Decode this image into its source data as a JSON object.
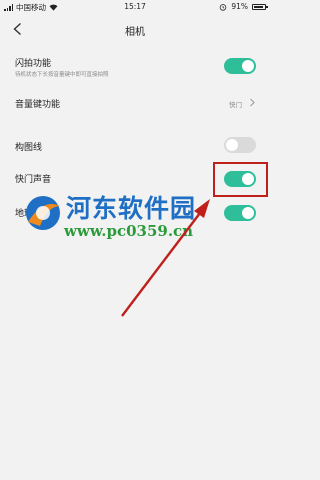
{
  "status_bar": {
    "carrier": "中国移动",
    "time": "15:17",
    "battery": "91%",
    "battery_level": 0.91
  },
  "header": {
    "title": "相机"
  },
  "settings": {
    "flash_capture": {
      "label": "闪拍功能",
      "description": "待机状态下长按音量键中即可直接拍照",
      "enabled": true
    },
    "volume_key": {
      "label": "音量键功能",
      "value": "快门"
    },
    "grid_lines": {
      "label": "构图线",
      "enabled": false
    },
    "shutter_sound": {
      "label": "快门声音",
      "enabled": true
    },
    "geo_tag": {
      "label": "地理位置",
      "enabled": true
    }
  },
  "watermark": {
    "name": "河东软件园",
    "url": "www.pc0359.cn"
  },
  "colors": {
    "toggle_on": "#2ebf9a",
    "annotation": "#c0201c"
  }
}
